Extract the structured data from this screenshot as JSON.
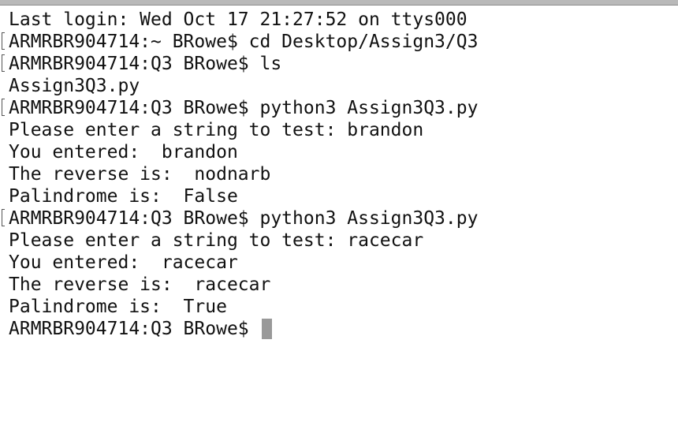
{
  "terminal": {
    "lines": [
      {
        "text": "Last login: Wed Oct 17 21:27:52 on ttys000",
        "marked": false
      },
      {
        "text": "ARMRBR904714:~ BRowe$ cd Desktop/Assign3/Q3",
        "marked": true
      },
      {
        "text": "ARMRBR904714:Q3 BRowe$ ls",
        "marked": true
      },
      {
        "text": "Assign3Q3.py",
        "marked": false
      },
      {
        "text": "ARMRBR904714:Q3 BRowe$ python3 Assign3Q3.py",
        "marked": true
      },
      {
        "text": "Please enter a string to test: brandon",
        "marked": false
      },
      {
        "text": "You entered:  brandon",
        "marked": false
      },
      {
        "text": "The reverse is:  nodnarb",
        "marked": false
      },
      {
        "text": "Palindrome is:  False",
        "marked": false
      },
      {
        "text": "ARMRBR904714:Q3 BRowe$ python3 Assign3Q3.py",
        "marked": true
      },
      {
        "text": "Please enter a string to test: racecar",
        "marked": false
      },
      {
        "text": "You entered:  racecar",
        "marked": false
      },
      {
        "text": "The reverse is:  racecar",
        "marked": false
      },
      {
        "text": "Palindrome is:  True",
        "marked": false
      }
    ],
    "prompt": "ARMRBR904714:Q3 BRowe$ "
  }
}
